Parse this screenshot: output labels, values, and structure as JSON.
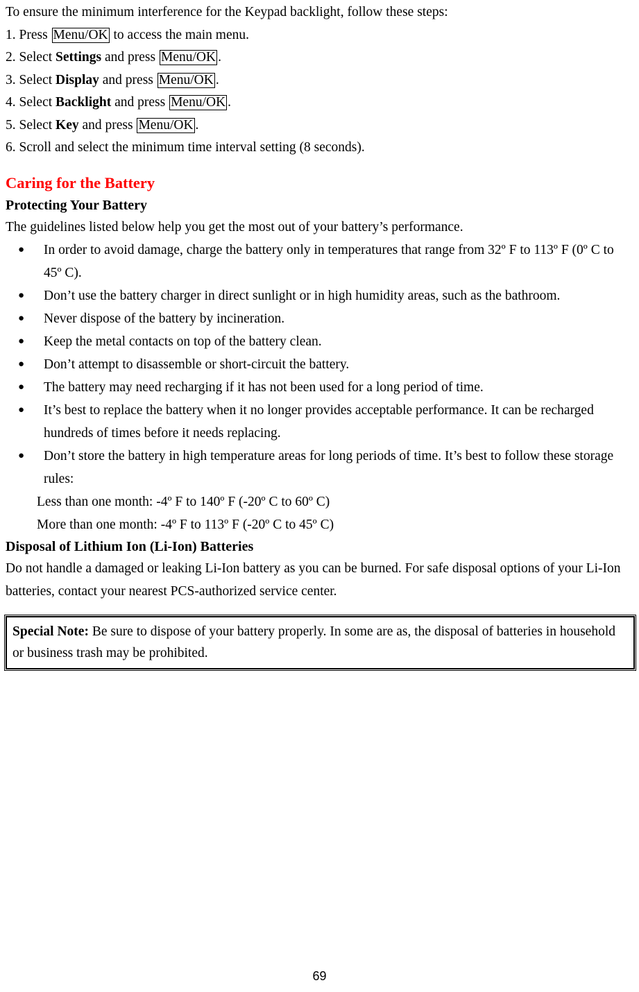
{
  "document": {
    "intro": "To ensure the minimum interference for the Keypad backlight, follow these steps:",
    "steps": [
      {
        "number": "1.",
        "pre": "Press ",
        "key": "Menu/OK",
        "post": " to access the main menu."
      },
      {
        "number": "2.",
        "pre": "Select ",
        "bold": "Settings",
        "mid": " and press ",
        "key": "Menu/OK",
        "post": "."
      },
      {
        "number": "3.",
        "pre": "Select ",
        "bold": "Display",
        "mid": " and press ",
        "key": "Menu/OK",
        "post": "."
      },
      {
        "number": "4.",
        "pre": "Select ",
        "bold": "Backlight",
        "mid": " and press ",
        "key": "Menu/OK",
        "post": "."
      },
      {
        "number": "5.",
        "pre": "Select ",
        "bold": "Key",
        "mid": " and press ",
        "key": "Menu/OK",
        "post": "."
      },
      {
        "number": "6.",
        "plain": "Scroll and select the minimum time interval setting (8 seconds)."
      }
    ],
    "heading_main": "Caring for the Battery",
    "heading_main_color": "#ff0000",
    "heading_sub": "Protecting Your Battery",
    "guidelines_intro": "The guidelines listed below help you get the most out of your battery’s performance.",
    "bullets": [
      "In order to avoid damage, charge the battery only in temperatures that range from 32º F to 113º F (0º C to 45º C).",
      "Don’t use the battery charger in direct sunlight or in high humidity areas, such as the bathroom.",
      "Never dispose of the battery by incineration.",
      "Keep the metal contacts on top of the battery clean.",
      "Don’t attempt to disassemble or short-circuit the battery.",
      "The battery may need recharging if it has not been used for a long period of time.",
      "It’s best to replace the battery when it no longer provides acceptable performance. It can be recharged hundreds of times before it needs replacing.",
      "Don’t store the battery in high temperature areas for long periods of time. It’s best to follow these storage rules:"
    ],
    "storage_rules": [
      "Less than one month: -4º F to 140º F (-20º C to 60º C)",
      "More than one month: -4º F to 113º F (-20º C to 45º C)"
    ],
    "heading_disposal": "Disposal of Lithium Ion (Li-Ion) Batteries",
    "disposal_text": "Do not handle a damaged or leaking Li-Ion battery as you can be burned. For safe disposal options of your Li-Ion batteries, contact your nearest PCS-authorized service center.",
    "special_note_label": "Special Note:",
    "special_note_text": " Be sure to dispose of your battery properly. In some are as, the disposal of batteries in household or business trash may be prohibited.",
    "page_number": "69"
  }
}
